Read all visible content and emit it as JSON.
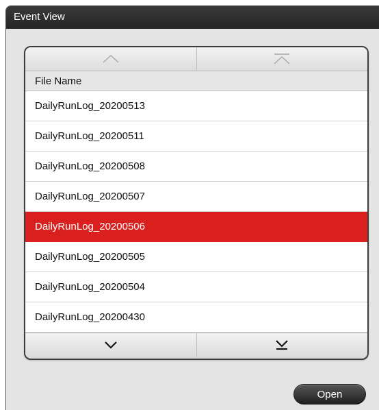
{
  "dialog": {
    "title": "Event View"
  },
  "list": {
    "column_header": "File Name",
    "selected_index": 4,
    "rows": [
      "DailyRunLog_20200513",
      "DailyRunLog_20200511",
      "DailyRunLog_20200508",
      "DailyRunLog_20200507",
      "DailyRunLog_20200506",
      "DailyRunLog_20200505",
      "DailyRunLog_20200504",
      "DailyRunLog_20200430"
    ]
  },
  "scroll": {
    "up_icon": "chevron-up-icon",
    "top_icon": "scroll-to-top-icon",
    "down_icon": "chevron-down-icon",
    "bottom_icon": "scroll-to-bottom-icon"
  },
  "actions": {
    "open_label": "Open"
  },
  "colors": {
    "selection": "#da1f1f",
    "titlebar": "#2e2e2e",
    "dialog_bg": "#e4e4e4"
  }
}
